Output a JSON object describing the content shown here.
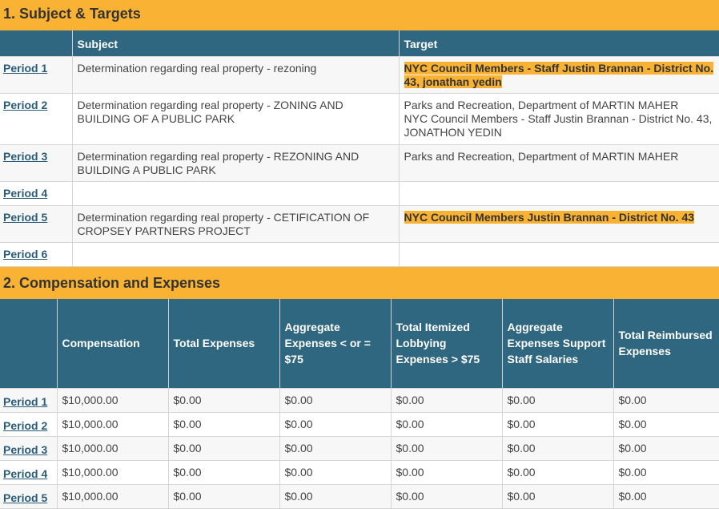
{
  "section1": {
    "title": "1. Subject & Targets",
    "headers": [
      "",
      "Subject",
      "Target"
    ],
    "rows": [
      {
        "period": "Period 1",
        "subject": "Determination regarding real property - rezoning",
        "target_lines": [
          "NYC Council Members - Staff Justin Brannan - District No. 43, jonathan yedin"
        ],
        "highlight": true
      },
      {
        "period": "Period 2",
        "subject": "Determination regarding real property - ZONING AND BUILDING OF A PUBLIC PARK",
        "target_lines": [
          "Parks and Recreation, Department of  MARTIN MAHER",
          "NYC Council Members - Staff Justin Brannan - District No. 43, JONATHON YEDIN"
        ],
        "highlight": false
      },
      {
        "period": "Period 3",
        "subject": "Determination regarding real property - REZONING AND BUILDING A PUBLIC PARK",
        "target_lines": [
          "Parks and Recreation, Department of  MARTIN MAHER"
        ],
        "highlight": false
      },
      {
        "period": "Period 4",
        "subject": "",
        "target_lines": [],
        "highlight": false
      },
      {
        "period": "Period 5",
        "subject": "Determination regarding real property - CETIFICATION OF CROPSEY PARTNERS PROJECT",
        "target_lines": [
          "NYC Council Members Justin Brannan - District No. 43"
        ],
        "highlight": true
      },
      {
        "period": "Period 6",
        "subject": "",
        "target_lines": [],
        "highlight": false
      }
    ]
  },
  "section2": {
    "title": "2. Compensation and Expenses",
    "headers": [
      "",
      "Compensation",
      "Total Expenses",
      "Aggregate Expenses < or = $75",
      "Total Itemized Lobbying Expenses > $75",
      "Aggregate Expenses Support Staff Salaries",
      "Total Reimbursed Expenses"
    ],
    "rows": [
      {
        "period": "Period 1",
        "values": [
          "$10,000.00",
          "$0.00",
          "$0.00",
          "$0.00",
          "$0.00",
          "$0.00"
        ]
      },
      {
        "period": "Period 2",
        "values": [
          "$10,000.00",
          "$0.00",
          "$0.00",
          "$0.00",
          "$0.00",
          "$0.00"
        ]
      },
      {
        "period": "Period 3",
        "values": [
          "$10,000.00",
          "$0.00",
          "$0.00",
          "$0.00",
          "$0.00",
          "$0.00"
        ]
      },
      {
        "period": "Period 4",
        "values": [
          "$10,000.00",
          "$0.00",
          "$0.00",
          "$0.00",
          "$0.00",
          "$0.00"
        ]
      },
      {
        "period": "Period 5",
        "values": [
          "$10,000.00",
          "$0.00",
          "$0.00",
          "$0.00",
          "$0.00",
          "$0.00"
        ]
      }
    ]
  },
  "colors": {
    "accent": "#f9b233",
    "header_bg": "#2f6680",
    "link": "#2a5c78"
  }
}
